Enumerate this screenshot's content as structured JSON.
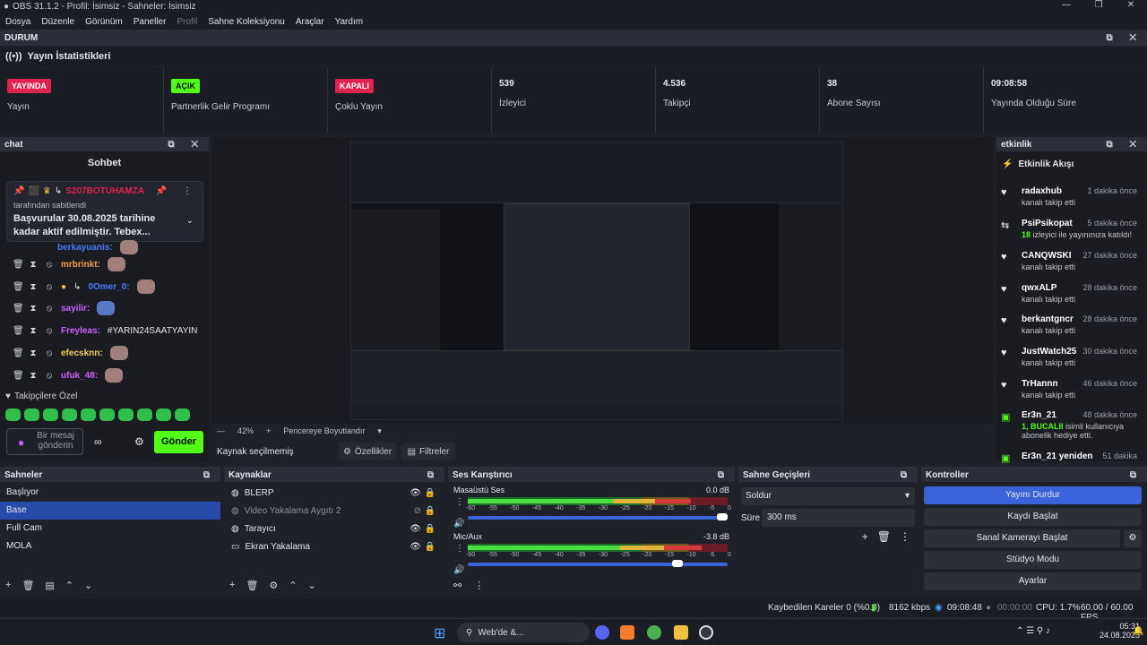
{
  "window": {
    "title": "OBS 31.1.2 - Profil: İsimsiz - Sahneler: İsimsiz"
  },
  "menu": [
    "Dosya",
    "Düzenle",
    "Görünüm",
    "Paneller",
    "Profil",
    "Sahne Koleksiyonu",
    "Araçlar",
    "Yardım"
  ],
  "status_dock": {
    "title": "DURUM"
  },
  "stats": {
    "title": "Yayın İstatistikleri",
    "items": [
      {
        "badge": "YAYINDA",
        "label": "Yayın",
        "color": "#e0234e"
      },
      {
        "badge": "AÇIK",
        "label": "Partnerlik Gelir Programı",
        "color": "#53fc18"
      },
      {
        "badge": "KAPALI",
        "label": "Çoklu Yayın",
        "color": "#e0234e"
      },
      {
        "value": "539",
        "label": "İzleyici"
      },
      {
        "value": "4.536",
        "label": "Takipçi"
      },
      {
        "value": "38",
        "label": "Abone Sayısı"
      },
      {
        "value": "09:08:58",
        "label": "Yayında Olduğu Süre"
      }
    ]
  },
  "chat": {
    "dock_title": "chat",
    "title": "Sohbet",
    "pinned_user": "S207BOTUHAMZA",
    "pinned_by": "tarafından sabitlendi",
    "pinned_text": "Başvurular 30.08.2025 tarihine kadar aktif edilmiştir. Tebex...",
    "partial_user": "berkayuanis:",
    "messages": [
      {
        "user": "mrbrinkt:",
        "text": "",
        "color": "#f0a050"
      },
      {
        "user": "0Omer_0:",
        "text": "",
        "color": "#4a7bff"
      },
      {
        "user": "sayilir:",
        "text": "",
        "color": "#c862ff"
      },
      {
        "user": "Freyleas:",
        "text": "#YARIN24SAATYAYIN",
        "color": "#c862ff"
      },
      {
        "user": "efecsknn:",
        "text": "",
        "color": "#f0d060"
      },
      {
        "user": "ufuk_48:",
        "text": "",
        "color": "#c862ff"
      }
    ],
    "emote_header": "Takipçilere Özel",
    "input_placeholder": "Bir mesaj gönderin",
    "send_label": "Gönder"
  },
  "preview": {
    "zoom": "42%",
    "fit_label": "Pencereye Boyutlandır",
    "no_source": "Kaynak seçilmemiş",
    "properties_label": "Özellikler",
    "filters_label": "Filtreler"
  },
  "events": {
    "dock_title": "etkinlik",
    "title": "Etkinlik Akışı",
    "items": [
      {
        "name": "radaxhub",
        "time": "1 dakika önce",
        "sub": "kanalı takip etti",
        "icon": "♥"
      },
      {
        "name": "PsiPsikopat",
        "time": "5 dakika önce",
        "sub_highlight": "18",
        "sub": "izleyici ile yayınınıza katıldı!",
        "icon": "⇆"
      },
      {
        "name": "CANQWSKI",
        "time": "27 dakika önce",
        "sub": "kanalı takip etti",
        "icon": "♥"
      },
      {
        "name": "qwxALP",
        "time": "28 dakika önce",
        "sub": "kanalı takip etti",
        "icon": "♥"
      },
      {
        "name": "berkantgncr",
        "time": "28 dakika önce",
        "sub": "kanalı takip etti",
        "icon": "♥"
      },
      {
        "name": "JustWatch25",
        "time": "30 dakika önce",
        "sub": "kanalı takip etti",
        "icon": "♥"
      },
      {
        "name": "TrHannn",
        "time": "46 dakika önce",
        "sub": "kanalı takip etti",
        "icon": "♥"
      },
      {
        "name": "Er3n_21",
        "time": "48 dakika önce",
        "sub_highlight": "1, BUCALII",
        "sub": "isimli kullanıcıya abonelik hediye etti.",
        "icon": "▣"
      },
      {
        "name": "Er3n_21 yeniden",
        "time": "51 dakika",
        "sub": "",
        "icon": "▣"
      }
    ]
  },
  "scenes": {
    "title": "Sahneler",
    "items": [
      "Başlıyor",
      "Base",
      "Full Cam",
      "MOLA"
    ],
    "selected": 1
  },
  "sources": {
    "title": "Kaynaklar",
    "items": [
      "BLERP",
      "Video Yakalama Aygıtı 2",
      "Tarayıcı",
      "Ekran Yakalama"
    ]
  },
  "mixer": {
    "title": "Ses Karıştırıcı",
    "channels": [
      {
        "name": "Masaüstü Ses",
        "db": "0.0 dB",
        "level": 0.86
      },
      {
        "name": "Mic/Aux",
        "db": "-3.8 dB",
        "level": 0.9
      }
    ],
    "ticks": [
      "-60",
      "-55",
      "-50",
      "-45",
      "-40",
      "-35",
      "-30",
      "-25",
      "-20",
      "-15",
      "-10",
      "-5",
      "0"
    ]
  },
  "transitions": {
    "title": "Sahne Geçişleri",
    "selected": "Soldur",
    "duration_label": "Süre",
    "duration": "300 ms"
  },
  "controls": {
    "title": "Kontroller",
    "buttons": [
      "Yayını Durdur",
      "Kaydı Başlat",
      "Sanal Kamerayı Başlat",
      "Stüdyo Modu",
      "Ayarlar"
    ]
  },
  "statusbar": {
    "dropped": "Kaybedilen Kareler 0 (%0.0)",
    "bitrate": "8162 kbps",
    "stream_time": "09:08:48",
    "rec_time": "00:00:00",
    "cpu": "CPU: 1.7%",
    "fps": "60.00 / 60.00 FPS"
  },
  "taskbar": {
    "search": "Web'de &...",
    "time": "05:31",
    "date": "24.08.2025"
  },
  "colors": {
    "accent": "#284aa9",
    "kick_green": "#53fc18",
    "live_red": "#e0234e",
    "button_blue": "#3b62d8"
  }
}
